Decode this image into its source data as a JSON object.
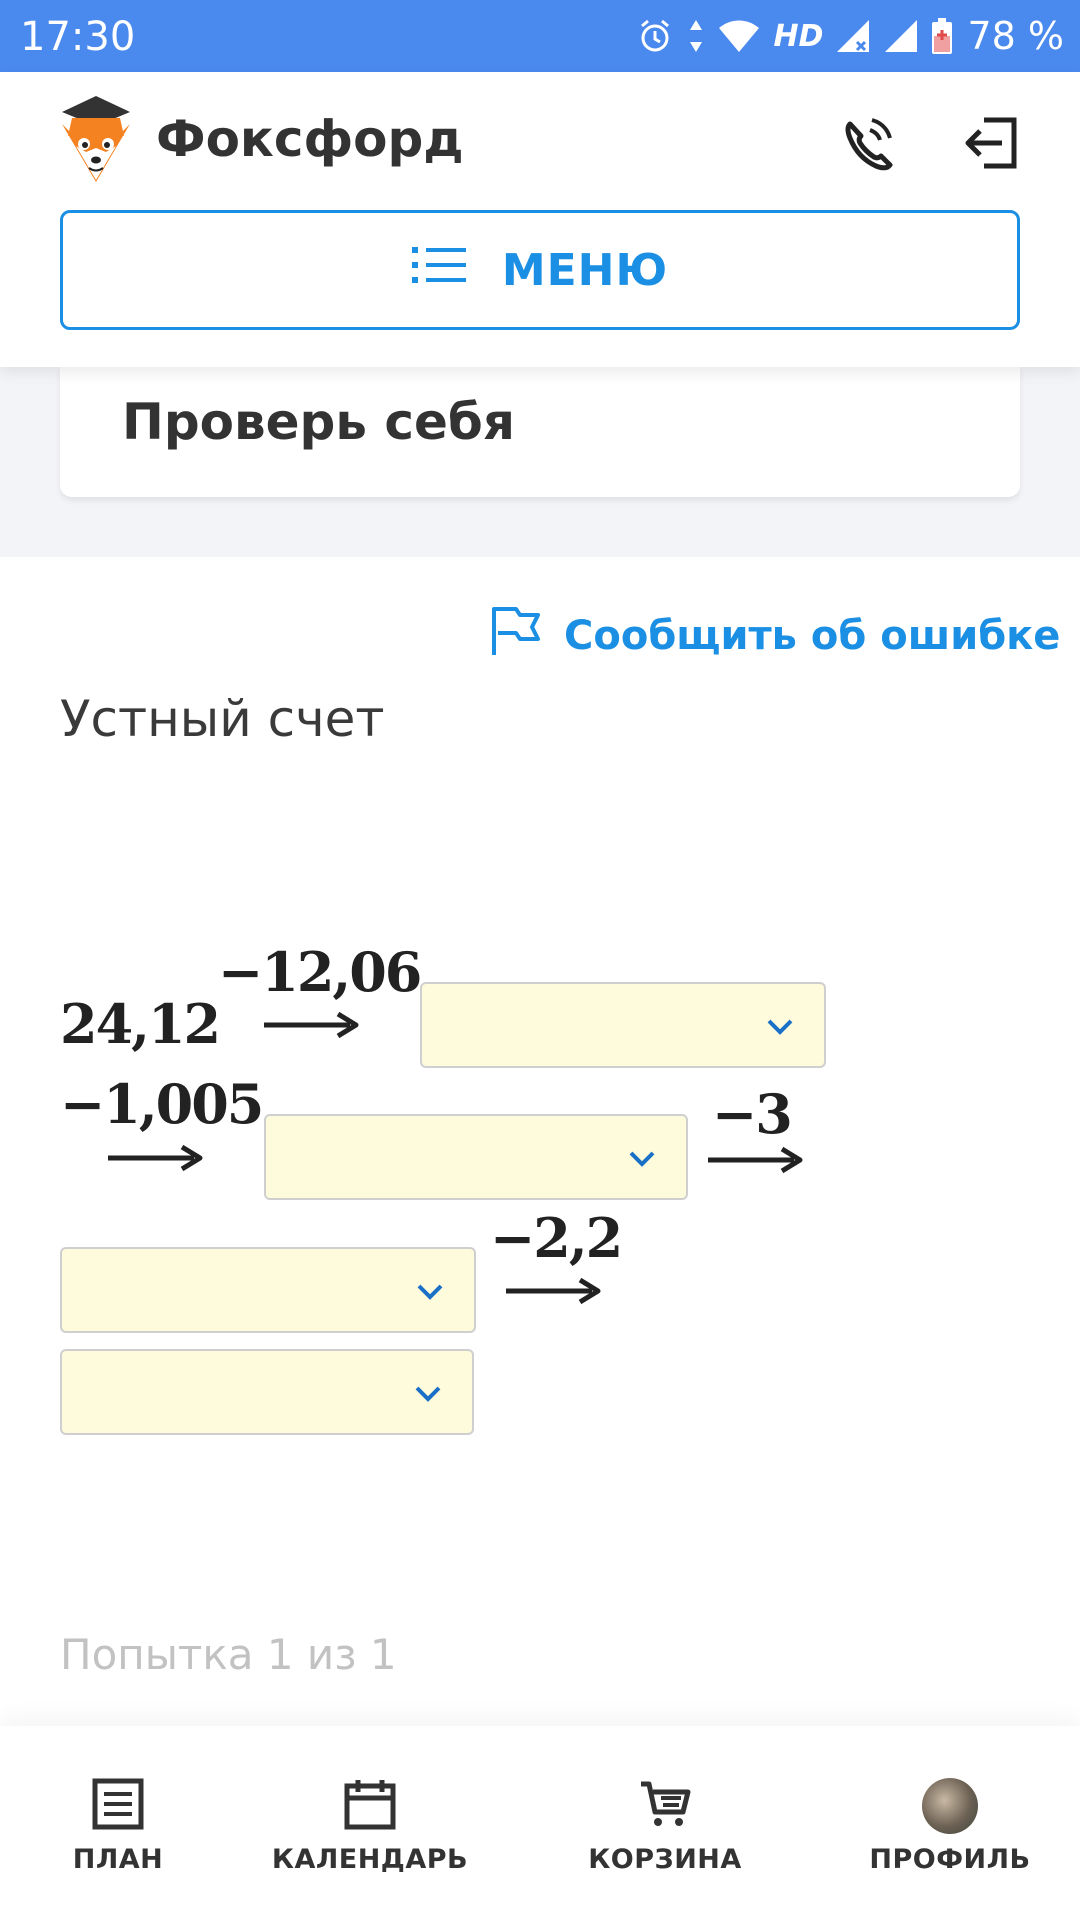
{
  "status_bar": {
    "time": "17:30",
    "network": "HD",
    "battery": "78 %"
  },
  "header": {
    "brand": "Фоксфорд",
    "menu_label": "МЕНЮ"
  },
  "section": {
    "title": "Проверь себя"
  },
  "report_error": "Сообщить об ошибке",
  "task": {
    "title": "Устный счет",
    "start_value": "24,12",
    "operations": [
      "−12,06",
      "−1,005",
      "−3",
      "−2,2"
    ],
    "answers": [
      "",
      "",
      "",
      ""
    ]
  },
  "attempt": "Попытка 1 из 1",
  "bottom_nav": [
    {
      "label": "ПЛАН",
      "icon": "plan-icon"
    },
    {
      "label": "КАЛЕНДАРЬ",
      "icon": "calendar-icon"
    },
    {
      "label": "КОРЗИНА",
      "icon": "cart-icon"
    },
    {
      "label": "ПРОФИЛЬ",
      "icon": "avatar"
    }
  ],
  "colors": {
    "accent": "#1a8fe3",
    "status_bar": "#4a89ee",
    "select_bg": "#fefbdc"
  }
}
